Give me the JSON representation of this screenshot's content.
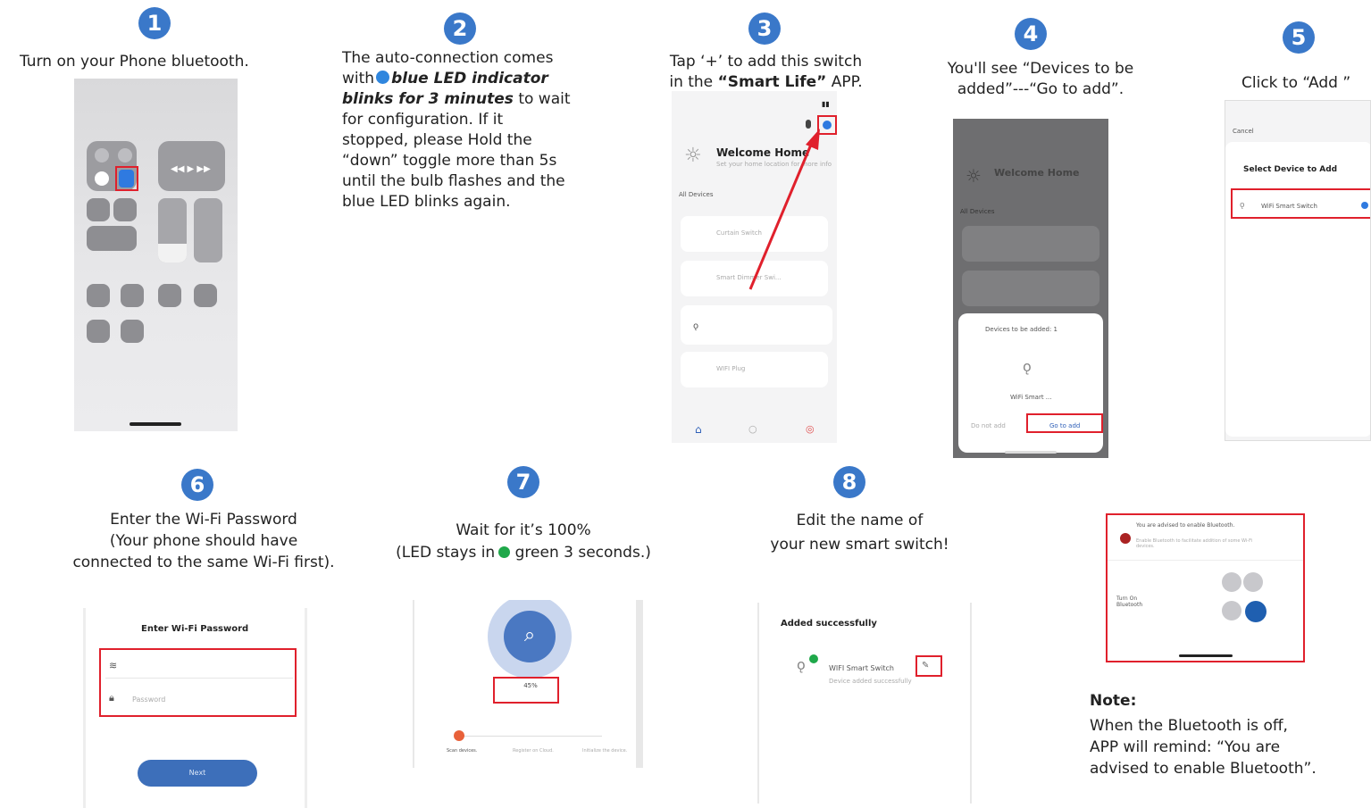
{
  "steps": {
    "s1": {
      "number": "1",
      "caption": "Turn on your Phone bluetooth."
    },
    "s2": {
      "number": "2",
      "line1": "The auto-connection comes",
      "with": "with",
      "emph1": "blue LED indicator",
      "emph2": "blinks for 3 minutes",
      "rest1": " to wait",
      "rest2": "for configuration. If it",
      "rest3": "stopped, please Hold the",
      "rest4": "“down” toggle more than 5s",
      "rest5": "until the bulb flashes and the",
      "rest6": "blue LED blinks again."
    },
    "s3": {
      "number": "3",
      "line1": "Tap ‘+’ to add this switch",
      "line2a": "in the ",
      "line2b": "“Smart Life”",
      "line2c": " APP."
    },
    "s4": {
      "number": "4",
      "line1": "You'll see “Devices to be",
      "line2": "added”---“Go to add”."
    },
    "s5": {
      "number": "5",
      "caption": "Click to “Add ”"
    },
    "s6": {
      "number": "6",
      "line1": "Enter the Wi-Fi Password",
      "line2": "(Your phone should have",
      "line3": "connected to the same Wi-Fi first)."
    },
    "s7": {
      "number": "7",
      "line1": "Wait for it’s 100%",
      "line2a": "(LED stays in",
      "line2b": " green 3 seconds.)"
    },
    "s8": {
      "number": "8",
      "line1": "Edit the name of",
      "line2": "your new smart switch!"
    }
  },
  "note": {
    "title": "Note:",
    "line1": "When the Bluetooth is off,",
    "line2": "APP will remind: “You are",
    "line3": "advised to enable Bluetooth”."
  },
  "shot3": {
    "welcome": "Welcome Home",
    "subtitle": "Set your home location for more info",
    "all_devices": "All Devices",
    "row1": "Curtain Switch",
    "row2": "Smart Dimmer Swi...",
    "row3": "WIFI Plug"
  },
  "shot4": {
    "welcome": "Welcome Home",
    "all_devices": "All Devices",
    "dialog_title": "Devices to be added: 1",
    "device": "WiFi Smart ...",
    "do_not_add": "Do not add",
    "go_to_add": "Go to add"
  },
  "shot5": {
    "cancel": "Cancel",
    "title": "Select Device to Add",
    "device": "WiFi Smart Switch"
  },
  "shot6": {
    "title": "Enter Wi-Fi Password",
    "password_placeholder": "Password",
    "next": "Next"
  },
  "shot7": {
    "percent": "45%",
    "step1": "Scan devices.",
    "step2": "Register on Cloud.",
    "step3": "Initialize the device."
  },
  "shot8": {
    "title": "Added successfully",
    "device": "WIFI Smart Switch",
    "sub": "Device added successfully"
  },
  "shot9": {
    "advice": "You are advised to enable Bluetooth.",
    "advice_sub": "Enable Bluetooth to facilitate addition of some Wi-Fi devices.",
    "turn_on": "Turn On Bluetooth"
  },
  "colors": {
    "accent": "#3a78c9",
    "highlight": "#e0202c",
    "green": "#1fa84a",
    "led_blue": "#2f86de"
  }
}
